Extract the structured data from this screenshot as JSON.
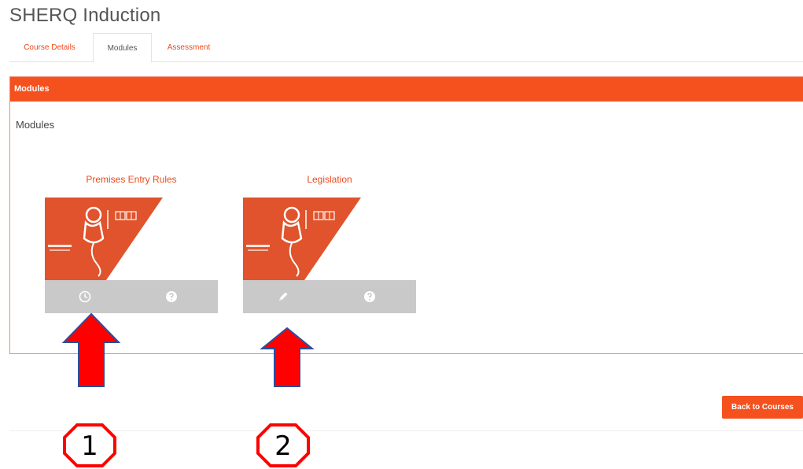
{
  "page": {
    "title": "SHERQ Induction"
  },
  "tabs": [
    {
      "label": "Course Details",
      "active": false
    },
    {
      "label": "Modules",
      "active": true
    },
    {
      "label": "Assessment",
      "active": false
    }
  ],
  "panel": {
    "header": "Modules",
    "subtitle": "Modules"
  },
  "modules": [
    {
      "title": "Premises Entry Rules",
      "action_icon": "clock-icon",
      "info_icon": "question-icon"
    },
    {
      "title": "Legislation",
      "action_icon": "pencil-icon",
      "info_icon": "question-icon"
    }
  ],
  "actions": {
    "back_label": "Back to Courses"
  },
  "annotations": {
    "badge_1": "1",
    "badge_2": "2"
  },
  "colors": {
    "accent": "#f4511e",
    "arrow": "#ff0000",
    "bar": "#c9c9c9"
  }
}
